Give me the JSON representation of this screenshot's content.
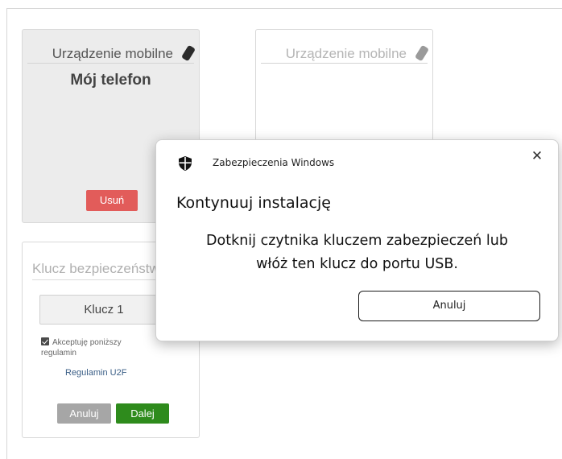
{
  "mobile_cards": [
    {
      "header": "Urządzenie mobilne",
      "device_name": "Mój telefon",
      "delete_label": "Usuń"
    },
    {
      "header": "Urządzenie mobilne"
    }
  ],
  "key_card": {
    "header": "Klucz bezpieczeństwa",
    "key_name": "Klucz 1",
    "accept_line1": "Akceptuję poniższy",
    "accept_line2": "regulamin",
    "terms_link": "Regulamin U2F",
    "cancel_label": "Anuluj",
    "next_label": "Dalej"
  },
  "dialog": {
    "app_name": "Zabezpieczenia Windows",
    "title": "Kontynuuj instalację",
    "message_line1": "Dotknij czytnika kluczem zabezpieczeń lub",
    "message_line2": "włóż ten klucz do portu USB.",
    "cancel_label": "Anuluj",
    "close_glyph": "✕"
  },
  "colors": {
    "delete": "#e25c5a",
    "next": "#2e8b1c",
    "cancel_small": "#a6a6a6",
    "link": "#3b5f87"
  },
  "icons": {
    "device": "smartphone-icon",
    "shield": "shield-icon",
    "close": "close-icon",
    "checkbox": "checkbox-checked"
  }
}
